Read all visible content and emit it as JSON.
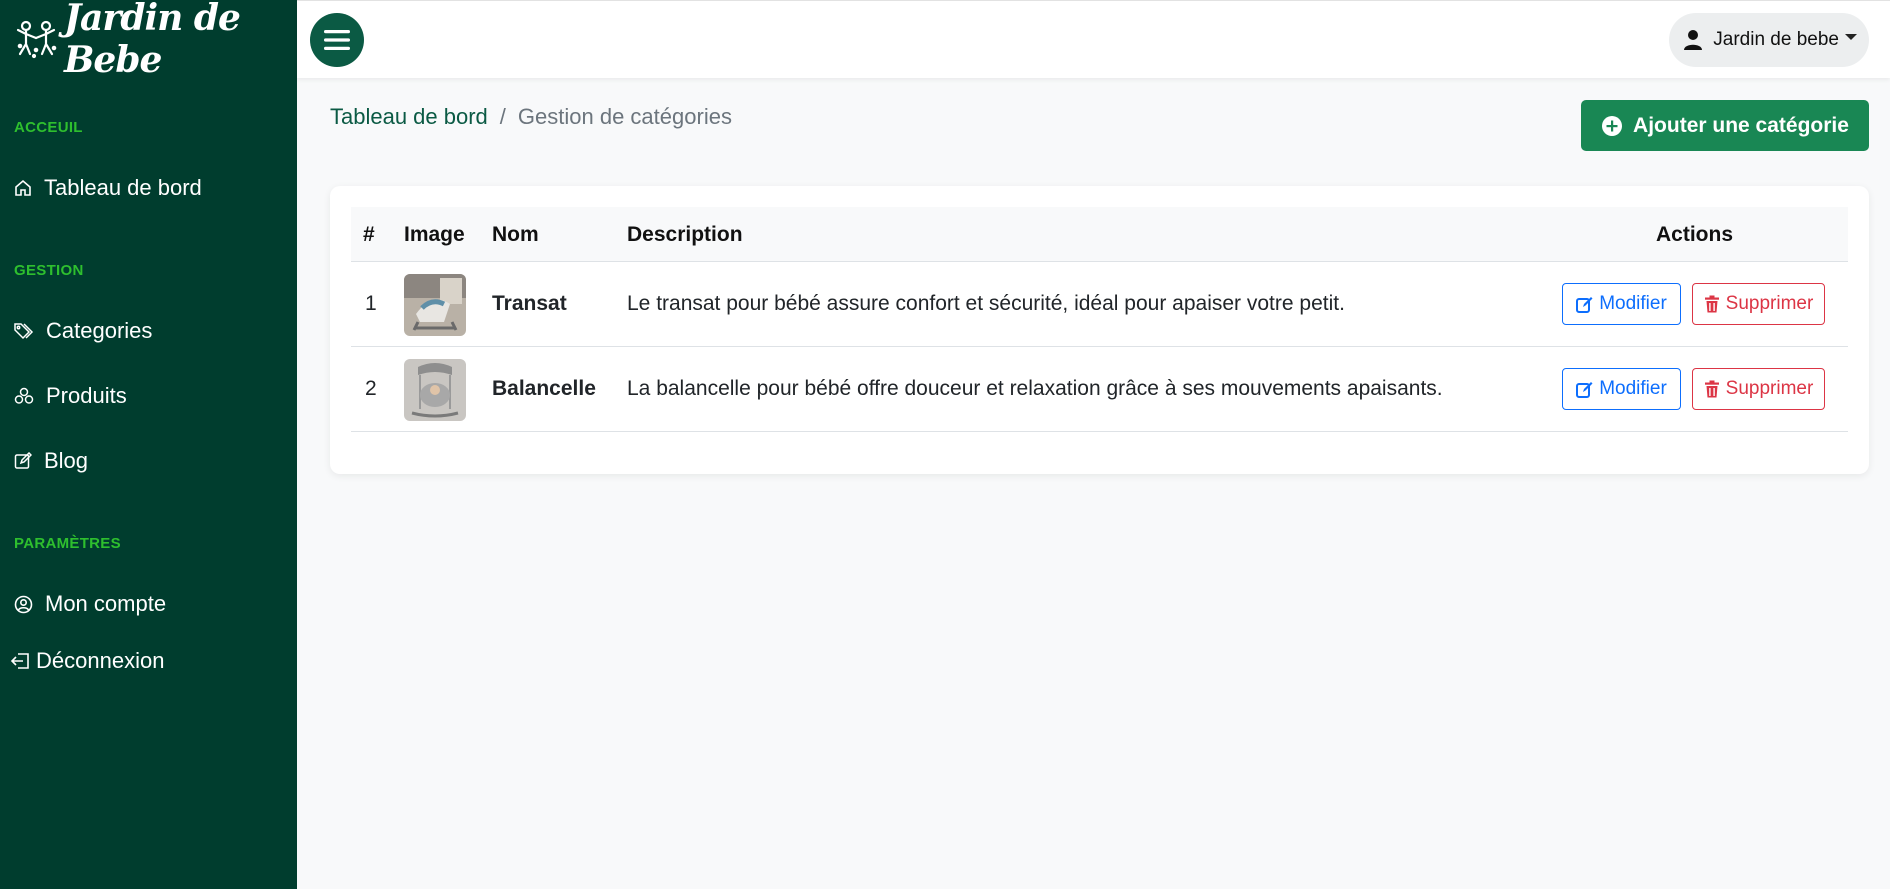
{
  "brand": {
    "name": "Jardin de Bebe",
    "logo_icon": "children-logo-icon"
  },
  "sidebar": {
    "sections": {
      "home": "ACCEUIL",
      "management": "GESTION",
      "settings": "PARAMÈTRES"
    },
    "items": {
      "dashboard": "Tableau de bord",
      "categories": "Categories",
      "products": "Produits",
      "blog": "Blog",
      "account": "Mon compte",
      "logout": "Déconnexion"
    }
  },
  "topbar": {
    "menu_icon": "hamburger-icon",
    "user_name": "Jardin de bebe"
  },
  "breadcrumb": {
    "home": "Tableau de bord",
    "separator": "/",
    "current": "Gestion de catégories"
  },
  "add_button": {
    "label": "Ajouter une catégorie"
  },
  "table": {
    "headers": {
      "index": "#",
      "image": "Image",
      "name": "Nom",
      "description": "Description",
      "actions": "Actions"
    },
    "rows": [
      {
        "index": "1",
        "name": "Transat",
        "description": "Le transat pour bébé assure confort et sécurité, idéal pour apaiser votre petit.",
        "edit": "Modifier",
        "delete": "Supprimer"
      },
      {
        "index": "2",
        "name": "Balancelle",
        "description": "La balancelle pour bébé offre douceur et relaxation grâce à ses mouvements apaisants.",
        "edit": "Modifier",
        "delete": "Supprimer"
      }
    ]
  },
  "colors": {
    "sidebar_bg": "#003d2e",
    "section_title": "#2ebf2e",
    "primary_green": "#198754",
    "link_green": "#0b5a44",
    "edit_blue": "#0d6efd",
    "delete_red": "#dc3545"
  }
}
